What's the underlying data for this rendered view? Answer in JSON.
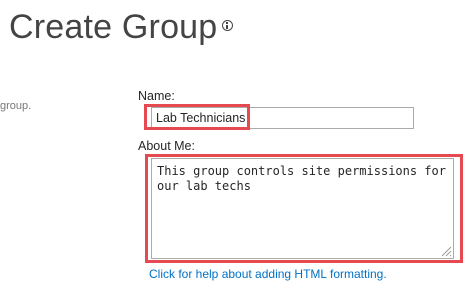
{
  "header": {
    "title": "Create Group",
    "info_icon": "info-circle-icon"
  },
  "sidebar": {
    "description_fragment": "group."
  },
  "form": {
    "name": {
      "label": "Name:",
      "value": "Lab Technicians"
    },
    "about": {
      "label": "About Me:",
      "value": "This group controls site permissions for our lab techs"
    },
    "help_link": "Click for help about adding HTML formatting."
  },
  "colors": {
    "highlight": "#e64a50",
    "link": "#0072c6",
    "title": "#444444"
  }
}
